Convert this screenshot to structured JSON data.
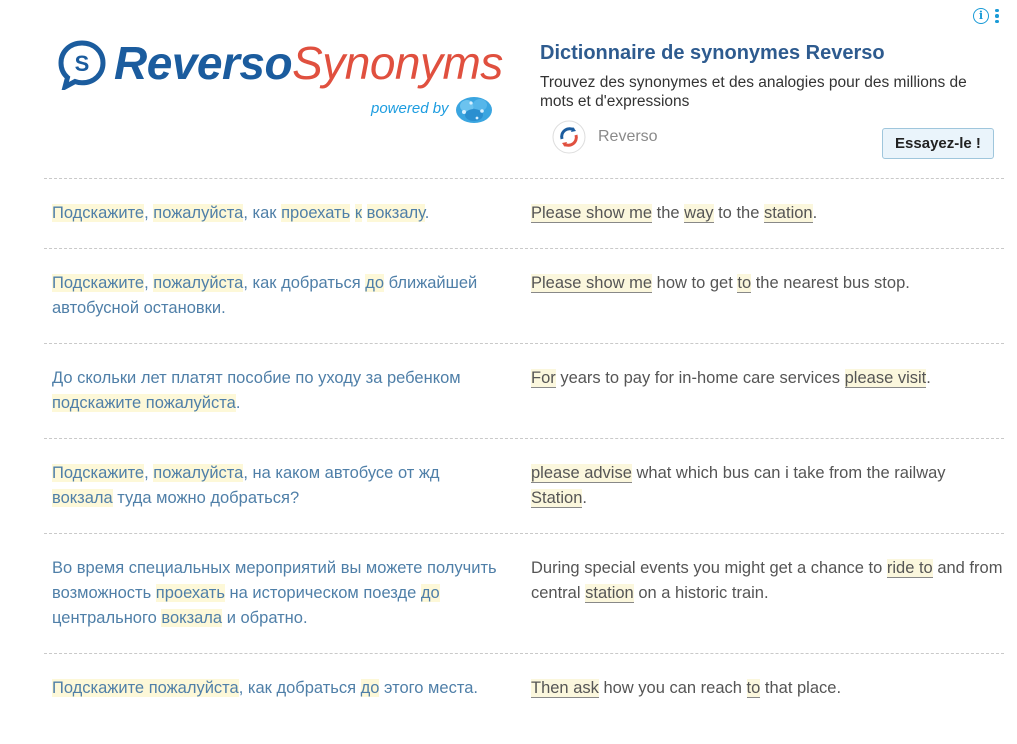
{
  "ad": {
    "logo": {
      "part1": "Reverso",
      "part2": "Synonyms",
      "powered_by": "powered by"
    },
    "title": "Dictionnaire de synonymes Reverso",
    "description": "Trouvez des synonymes et des analogies pour des millions de mots et d'expressions",
    "brand_name": "Reverso",
    "cta_label": "Essayez-le !",
    "info_icon": "i"
  },
  "examples": [
    {
      "ru": [
        {
          "t": "Подскажите",
          "h": true
        },
        {
          "t": ", "
        },
        {
          "t": "пожалуйста",
          "h": true
        },
        {
          "t": ", как "
        },
        {
          "t": "проехать",
          "h": true
        },
        {
          "t": " "
        },
        {
          "t": "к",
          "h": true
        },
        {
          "t": " "
        },
        {
          "t": "вокзалу",
          "h": true
        },
        {
          "t": "."
        }
      ],
      "en": [
        {
          "t": "Please show me",
          "h": true
        },
        {
          "t": " the "
        },
        {
          "t": "way",
          "h": true
        },
        {
          "t": " to the "
        },
        {
          "t": "station",
          "h": true
        },
        {
          "t": "."
        }
      ]
    },
    {
      "ru": [
        {
          "t": "Подскажите",
          "h": true
        },
        {
          "t": ", "
        },
        {
          "t": "пожалуйста",
          "h": true
        },
        {
          "t": ", как добраться "
        },
        {
          "t": "до",
          "h": true
        },
        {
          "t": " ближайшей автобусной остановки."
        }
      ],
      "en": [
        {
          "t": "Please show me",
          "h": true
        },
        {
          "t": " how to get "
        },
        {
          "t": "to",
          "h": true
        },
        {
          "t": " the nearest bus stop."
        }
      ]
    },
    {
      "ru": [
        {
          "t": "До скольки лет платят пособие по уходу за ребенком "
        },
        {
          "t": "подскажите пожалуйста",
          "h": true
        },
        {
          "t": "."
        }
      ],
      "en": [
        {
          "t": "For",
          "h": true
        },
        {
          "t": " years to pay for in-home care services "
        },
        {
          "t": "please visit",
          "h": true
        },
        {
          "t": "."
        }
      ]
    },
    {
      "ru": [
        {
          "t": "Подскажите",
          "h": true
        },
        {
          "t": ", "
        },
        {
          "t": "пожалуйста",
          "h": true
        },
        {
          "t": ", на каком автобусе от жд "
        },
        {
          "t": "вокзала",
          "h": true
        },
        {
          "t": " туда можно добраться?"
        }
      ],
      "en": [
        {
          "t": "please advise",
          "h": true
        },
        {
          "t": " what which bus can i take from the railway "
        },
        {
          "t": "Station",
          "h": true
        },
        {
          "t": "."
        }
      ]
    },
    {
      "ru": [
        {
          "t": "Во время специальных мероприятий вы можете получить возможность "
        },
        {
          "t": "проехать",
          "h": true
        },
        {
          "t": " на историческом поезде "
        },
        {
          "t": "до",
          "h": true
        },
        {
          "t": " центрального "
        },
        {
          "t": "вокзала",
          "h": true
        },
        {
          "t": " и обратно."
        }
      ],
      "en": [
        {
          "t": "During special events you might get a chance to "
        },
        {
          "t": "ride to",
          "h": true
        },
        {
          "t": " and from central "
        },
        {
          "t": "station",
          "h": true
        },
        {
          "t": " on a historic train."
        }
      ]
    },
    {
      "ru": [
        {
          "t": "Подскажите пожалуйста",
          "h": true
        },
        {
          "t": ", как добраться "
        },
        {
          "t": "до",
          "h": true
        },
        {
          "t": " этого места."
        }
      ],
      "en": [
        {
          "t": "Then ask",
          "h": true
        },
        {
          "t": " how you can reach "
        },
        {
          "t": "to",
          "h": true
        },
        {
          "t": " that place."
        }
      ]
    }
  ],
  "colors": {
    "ru_text": "#4f7fa8",
    "en_text": "#555555",
    "highlight": "#fdf8d8",
    "logo_blue": "#1b5c9e",
    "logo_red": "#e0503f",
    "title_blue": "#2e5b8f"
  }
}
